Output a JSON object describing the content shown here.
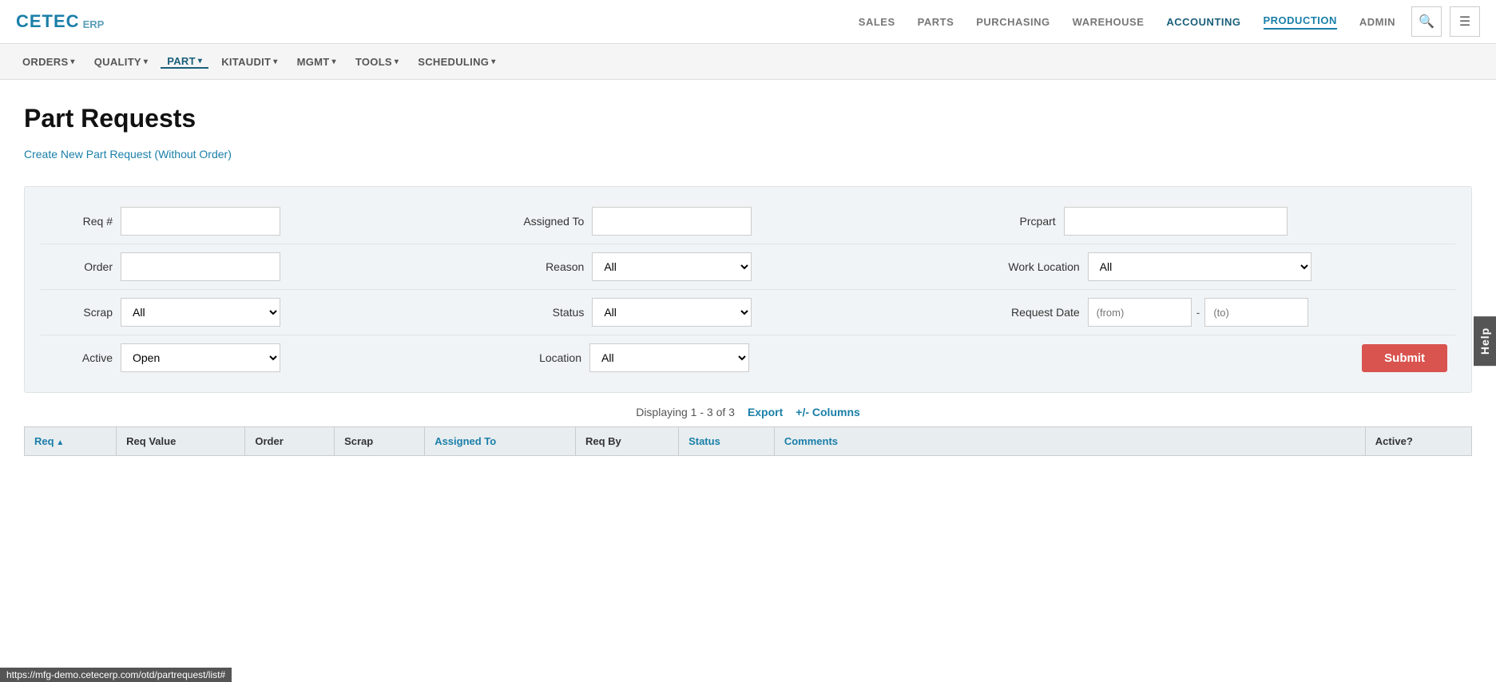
{
  "logo": {
    "cetec": "CETEC",
    "erp": "ERP"
  },
  "topnav": {
    "links": [
      {
        "label": "SALES",
        "active": false
      },
      {
        "label": "PARTS",
        "active": false
      },
      {
        "label": "PURCHASING",
        "active": false
      },
      {
        "label": "WAREHOUSE",
        "active": false
      },
      {
        "label": "ACCOUNTING",
        "active": false,
        "accounting": true
      },
      {
        "label": "PRODUCTION",
        "active": true
      },
      {
        "label": "ADMIN",
        "active": false
      }
    ]
  },
  "secondarynav": {
    "links": [
      {
        "label": "ORDERS",
        "caret": "▾",
        "active": false
      },
      {
        "label": "QUALITY",
        "caret": "▾",
        "active": false
      },
      {
        "label": "PART",
        "caret": "▾",
        "active": true
      },
      {
        "label": "KITAUDIT",
        "caret": "▾",
        "active": false
      },
      {
        "label": "MGMT",
        "caret": "▾",
        "active": false
      },
      {
        "label": "TOOLS",
        "caret": "▾",
        "active": false
      },
      {
        "label": "SCHEDULING",
        "caret": "▾",
        "active": false
      }
    ]
  },
  "page": {
    "title": "Part Requests",
    "create_link": "Create New Part Request (Without Order)"
  },
  "filters": {
    "req_num": {
      "label": "Req #",
      "placeholder": ""
    },
    "assigned_to": {
      "label": "Assigned To",
      "placeholder": ""
    },
    "prcpart": {
      "label": "Prcpart",
      "placeholder": ""
    },
    "order": {
      "label": "Order",
      "placeholder": ""
    },
    "reason": {
      "label": "Reason",
      "default": "All"
    },
    "work_location": {
      "label": "Work Location",
      "default": "All"
    },
    "scrap": {
      "label": "Scrap",
      "default": "All"
    },
    "status": {
      "label": "Status",
      "default": "All"
    },
    "request_date_label": "Request Date",
    "request_date_from_placeholder": "(from)",
    "request_date_to_placeholder": "(to)",
    "date_dash": "-",
    "active": {
      "label": "Active",
      "default": "Open"
    },
    "location": {
      "label": "Location",
      "default": "All"
    },
    "submit_label": "Submit"
  },
  "results": {
    "display_text": "Displaying 1 - 3 of 3",
    "export_label": "Export",
    "columns_label": "+/- Columns"
  },
  "table": {
    "headers": [
      {
        "label": "Req",
        "sorted": true,
        "direction": "asc"
      },
      {
        "label": "Req Value"
      },
      {
        "label": "Order"
      },
      {
        "label": "Scrap"
      },
      {
        "label": "Assigned To",
        "sorted": false
      },
      {
        "label": "Req By"
      },
      {
        "label": "Status",
        "sorted": false
      },
      {
        "label": "Comments"
      },
      {
        "label": "Active?"
      }
    ]
  },
  "help_label": "Help",
  "status_bar_url": "https://mfg-demo.cetecerp.com/otd/partrequest/list#"
}
